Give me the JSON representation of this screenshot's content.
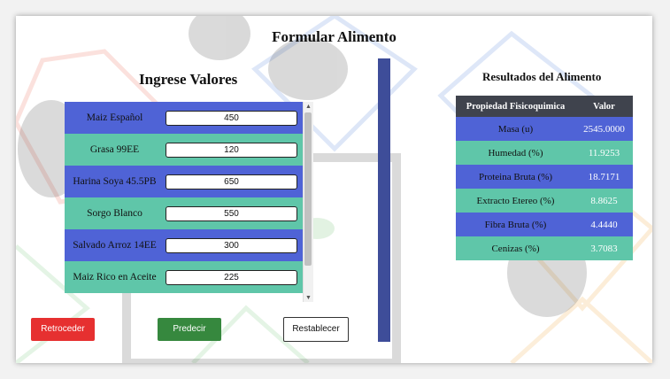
{
  "app": {
    "title": "Formular Alimento"
  },
  "form": {
    "heading": "Ingrese Valores",
    "rows": [
      {
        "label": "Maiz Español",
        "value": "450"
      },
      {
        "label": "Grasa 99EE",
        "value": "120"
      },
      {
        "label": "Harina Soya 45.5PB",
        "value": "650"
      },
      {
        "label": "Sorgo Blanco",
        "value": "550"
      },
      {
        "label": "Salvado Arroz 14EE",
        "value": "300"
      },
      {
        "label": "Maiz Rico en Aceite",
        "value": "225"
      }
    ]
  },
  "buttons": {
    "back": "Retroceder",
    "predict": "Predecir",
    "reset": "Restablecer"
  },
  "results": {
    "heading": "Resultados del Alimento",
    "columns": [
      "Propiedad Fisicoquimica",
      "Valor"
    ],
    "rows": [
      {
        "property": "Masa (u)",
        "value": "2545.0000"
      },
      {
        "property": "Humedad (%)",
        "value": "11.9253"
      },
      {
        "property": "Proteina Bruta (%)",
        "value": "18.7171"
      },
      {
        "property": "Extracto Etereo (%)",
        "value": "8.8625"
      },
      {
        "property": "Fibra Bruta (%)",
        "value": "4.4440"
      },
      {
        "property": "Cenizas (%)",
        "value": "3.7083"
      }
    ]
  },
  "colors": {
    "row_blue": "#4f63d6",
    "row_teal": "#5fc6a9",
    "divider": "#3e4d99",
    "back_button": "#e63030",
    "predict_button": "#36883e",
    "table_header": "#3f434d"
  },
  "icons": {
    "scroll_up": "triangle-up",
    "scroll_down": "triangle-down"
  }
}
